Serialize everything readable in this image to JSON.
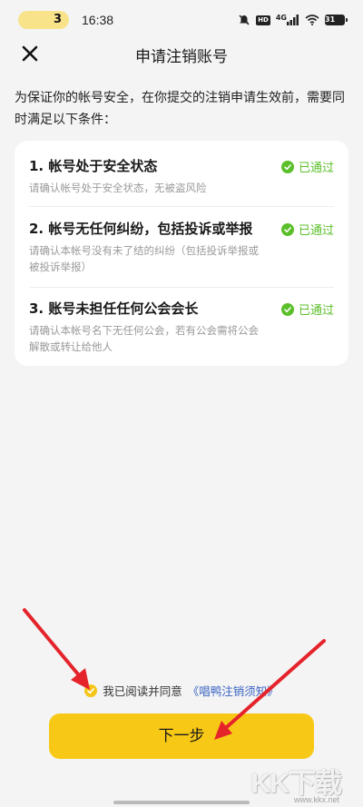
{
  "status_bar": {
    "pill_number": "3",
    "time": "16:38",
    "hd_label": "HD",
    "network_label": "4G",
    "battery": "31"
  },
  "header": {
    "title": "申请注销账号"
  },
  "intro_text": "为保证你的帐号安全，在你提交的注销申请生效前，需要同时满足以下条件：",
  "conditions": [
    {
      "title": "1. 帐号处于安全状态",
      "desc": "请确认帐号处于安全状态，无被盗风险",
      "status": "已通过"
    },
    {
      "title": "2. 帐号无任何纠纷，包括投诉或举报",
      "desc": "请确认本帐号没有未了结的纠纷（包括投诉举报或被投诉举报）",
      "status": "已通过"
    },
    {
      "title": "3. 账号未担任任何公会会长",
      "desc": "请确认本帐号名下无任何公会，若有公会需将公会解散或转让给他人",
      "status": "已通过"
    }
  ],
  "agreement": {
    "text": "我已阅读并同意",
    "link": "《唱鸭注销须知》"
  },
  "next_button": "下一步",
  "watermark": {
    "text": "KK下载",
    "url": "www.kkx.net"
  },
  "colors": {
    "accent": "#f8c816",
    "pass_green": "#5bbf2a",
    "link_blue": "#3a63c4",
    "arrow_red": "#e5232b"
  },
  "icons": [
    "close-icon",
    "check-icon",
    "mute-icon",
    "wifi-icon",
    "signal-icon",
    "battery-icon"
  ]
}
